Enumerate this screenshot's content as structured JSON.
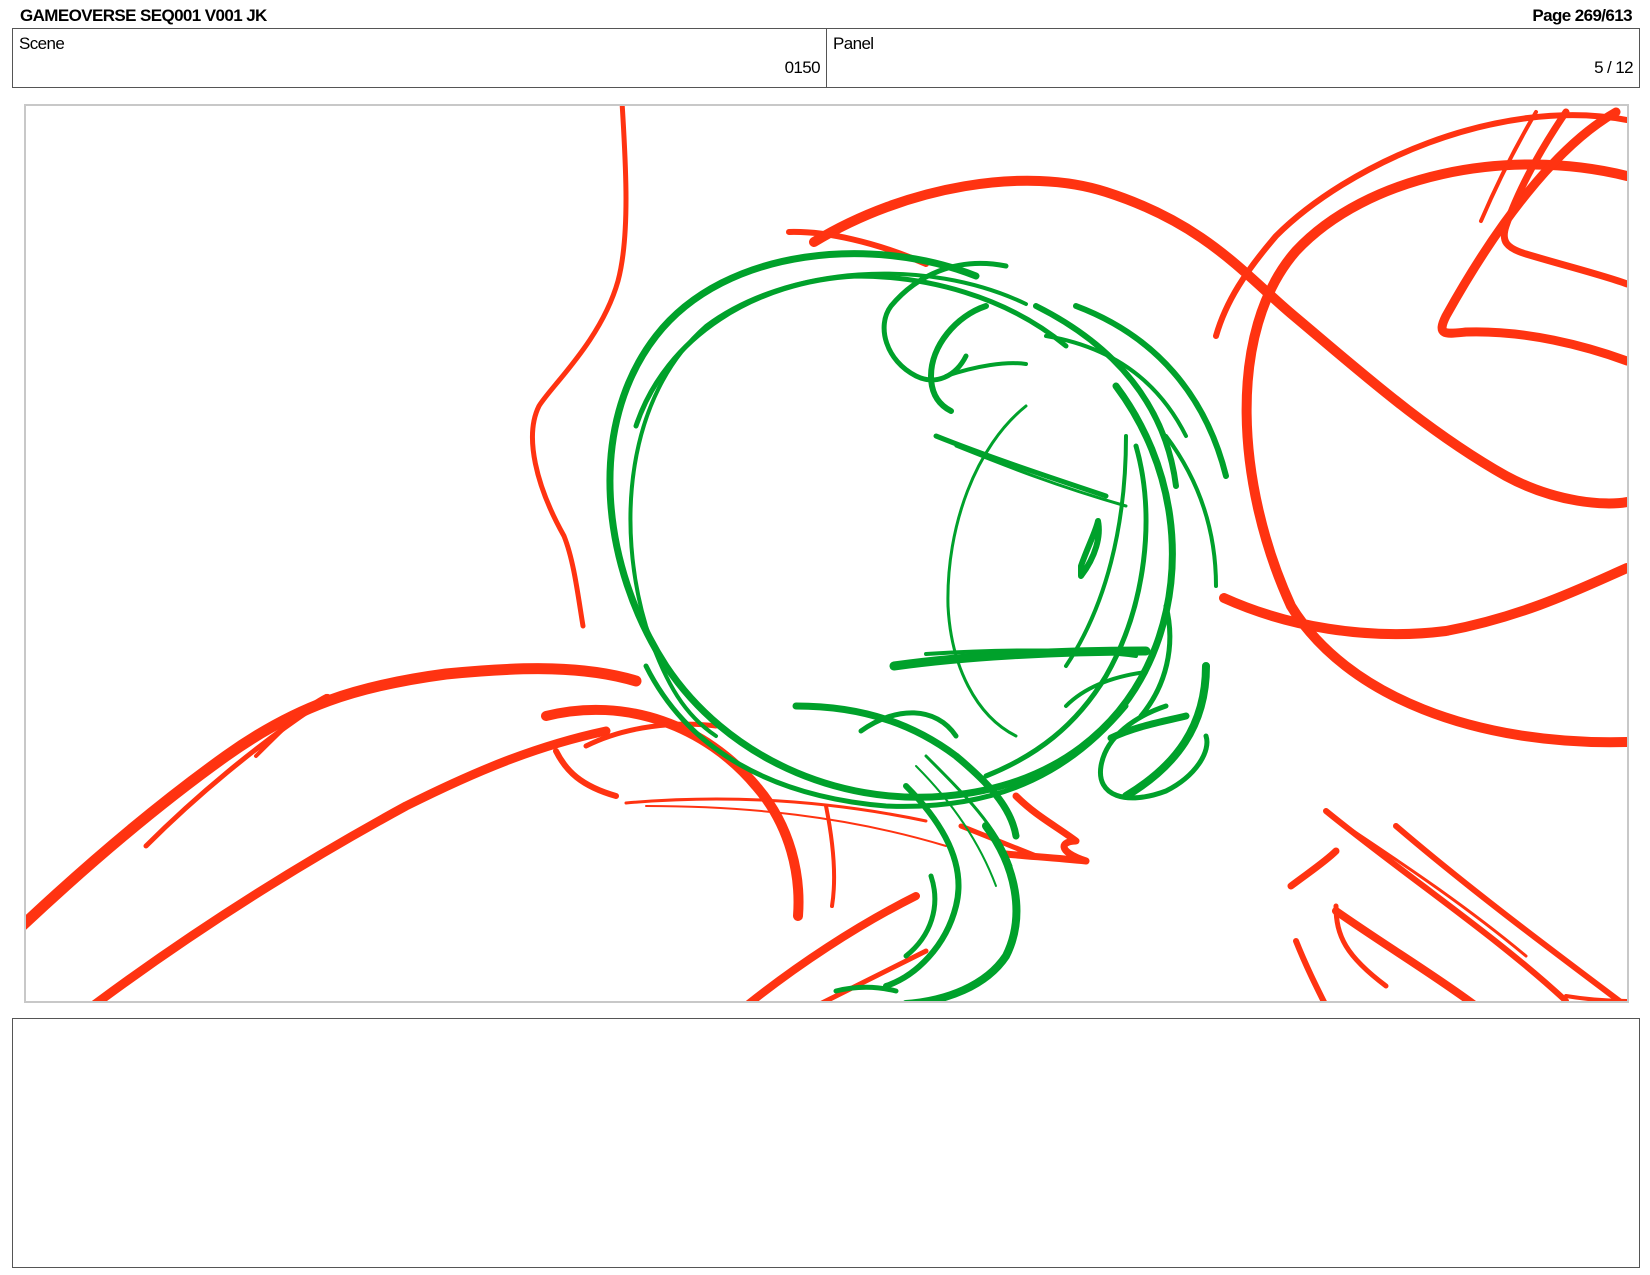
{
  "header": {
    "title": "GAMEOVERSE SEQ001 V001 JK",
    "page": "Page 269/613"
  },
  "info": {
    "scene_label": "Scene",
    "scene_value": "0150",
    "panel_label": "Panel",
    "panel_value": "5 / 12"
  },
  "sketch": {
    "red_color": "#ff3311",
    "green_color": "#00a12b"
  },
  "notes": {
    "text": ""
  }
}
